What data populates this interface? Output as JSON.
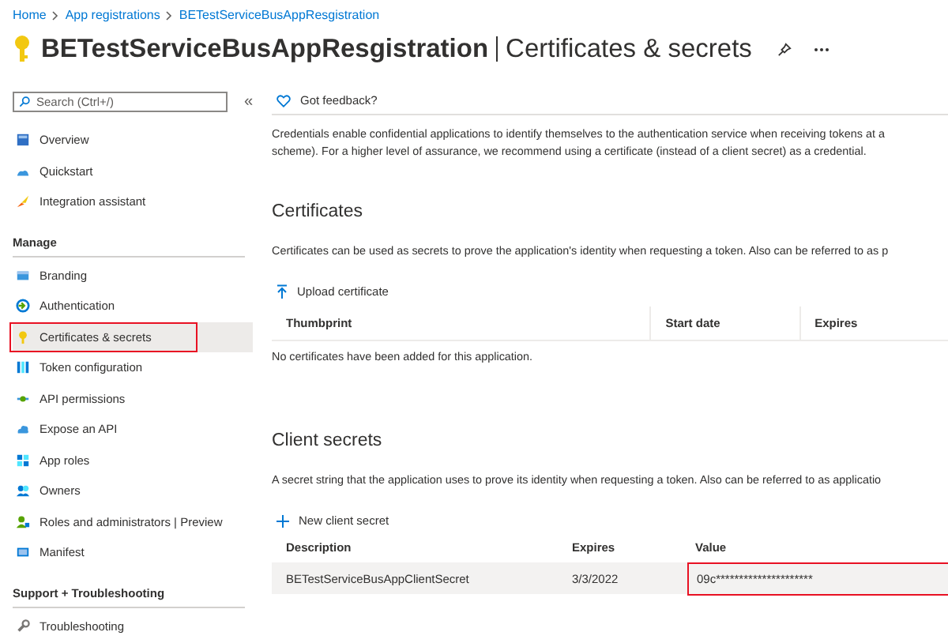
{
  "breadcrumb": [
    "Home",
    "App registrations",
    "BETestServiceBusAppResgistration"
  ],
  "title": {
    "app": "BETestServiceBusAppResgistration",
    "page": "Certificates & secrets"
  },
  "sidebar": {
    "search": {
      "placeholder": "Search (Ctrl+/)"
    },
    "collapse": "«",
    "groups": [
      {
        "items": [
          {
            "label": "Overview",
            "selected": false,
            "highlighted": false
          },
          {
            "label": "Quickstart",
            "selected": false,
            "highlighted": false
          },
          {
            "label": "Integration assistant",
            "selected": false,
            "highlighted": false
          }
        ]
      },
      {
        "heading": "Manage",
        "items": [
          {
            "label": "Branding",
            "selected": false,
            "highlighted": false
          },
          {
            "label": "Authentication",
            "selected": false,
            "highlighted": false
          },
          {
            "label": "Certificates & secrets",
            "selected": true,
            "highlighted": true
          },
          {
            "label": "Token configuration",
            "selected": false,
            "highlighted": false
          },
          {
            "label": "API permissions",
            "selected": false,
            "highlighted": false
          },
          {
            "label": "Expose an API",
            "selected": false,
            "highlighted": false
          },
          {
            "label": "App roles",
            "selected": false,
            "highlighted": false
          },
          {
            "label": "Owners",
            "selected": false,
            "highlighted": false
          },
          {
            "label": "Roles and administrators | Preview",
            "selected": false,
            "highlighted": false
          },
          {
            "label": "Manifest",
            "selected": false,
            "highlighted": false
          }
        ]
      },
      {
        "heading": "Support + Troubleshooting",
        "items": [
          {
            "label": "Troubleshooting",
            "selected": false,
            "highlighted": false
          }
        ]
      }
    ]
  },
  "feedback": "Got feedback?",
  "intro": [
    "Credentials enable confidential applications to identify themselves to the authentication service when receiving tokens at a",
    "scheme). For a higher level of assurance, we recommend using a certificate (instead of a client secret) as a credential."
  ],
  "certificates": {
    "heading": "Certificates",
    "description": "Certificates can be used as secrets to prove the application's identity when requesting a token. Also can be referred to as p",
    "action": "Upload certificate",
    "columns": [
      "Thumbprint",
      "Start date",
      "Expires"
    ],
    "empty": "No certificates have been added for this application."
  },
  "client_secrets": {
    "heading": "Client secrets",
    "description": "A secret string that the application uses to prove its identity when requesting a token. Also can be referred to as applicatio",
    "action": "New client secret",
    "columns": [
      "Description",
      "Expires",
      "Value"
    ],
    "rows": [
      {
        "description": "BETestServiceBusAppClientSecret",
        "expires": "3/3/2022",
        "value": "09c*********************",
        "value_highlighted": true
      }
    ]
  }
}
